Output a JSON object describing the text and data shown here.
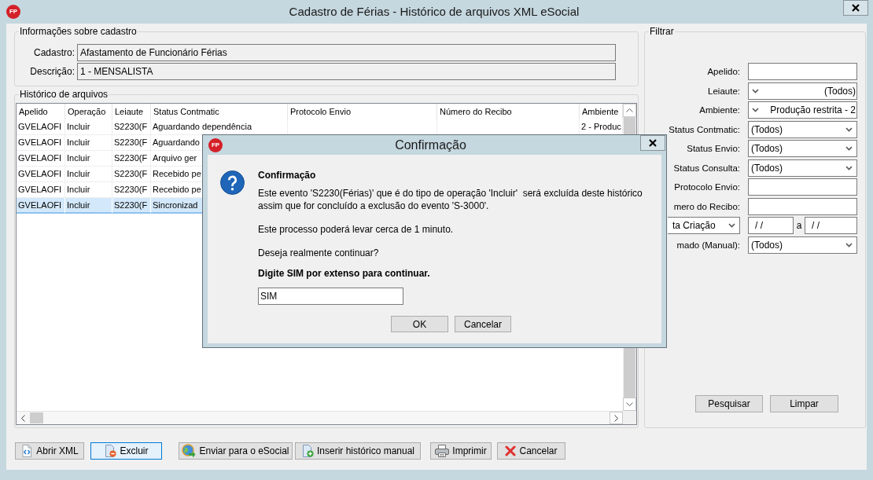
{
  "window": {
    "logo": "FP",
    "title": "Cadastro de Férias - Histórico de arquivos XML eSocial"
  },
  "cadastro_info": {
    "title": "Informações sobre cadastro",
    "fields": [
      {
        "label": "Cadastro:",
        "value": "Afastamento de Funcionário Férias"
      },
      {
        "label": "Descrição:",
        "value": "1 - MENSALISTA"
      }
    ]
  },
  "history": {
    "title": "Histórico de arquivos",
    "table": {
      "columns": [
        "Apelido",
        "Operação",
        "Leiaute",
        "Status Contmatic",
        "Protocolo Envio",
        "Número do Recibo",
        "Ambiente"
      ],
      "rows": [
        {
          "apelido": "GVELAOFI",
          "operacao": "Incluir",
          "leiaute": "S2230(F",
          "status_contmatic": "Aguardando dependência",
          "ambiente": "2 - Produc",
          "selected": false
        },
        {
          "apelido": "GVELAOFI",
          "operacao": "Incluir",
          "leiaute": "S2230(F",
          "status_contmatic": "Aguardando",
          "selected": false
        },
        {
          "apelido": "GVELAOFI",
          "operacao": "Incluir",
          "leiaute": "S2230(F",
          "status_contmatic": "Arquivo ger",
          "selected": false
        },
        {
          "apelido": "GVELAOFI",
          "operacao": "Incluir",
          "leiaute": "S2230(F",
          "status_contmatic": "Recebido pe",
          "selected": false
        },
        {
          "apelido": "GVELAOFI",
          "operacao": "Incluir",
          "leiaute": "S2230(F",
          "status_contmatic": "Recebido pe",
          "selected": false
        },
        {
          "apelido": "GVELAOFI",
          "operacao": "Incluir",
          "leiaute": "S2230(F",
          "status_contmatic": "Sincronizad",
          "selected": true
        }
      ]
    }
  },
  "filter": {
    "title": "Filtrar",
    "fields": [
      {
        "kind": "text",
        "label": "Apelido:"
      },
      {
        "kind": "picker",
        "label": "Leiaute:",
        "value": "(Todos)"
      },
      {
        "kind": "picker",
        "label": "Ambiente:",
        "value": "Produção restrita - 2"
      },
      {
        "kind": "dropdown",
        "label": "Status Contmatic:",
        "value": "(Todos)"
      },
      {
        "kind": "dropdown",
        "label": "Status Envio:",
        "value": "(Todos)"
      },
      {
        "kind": "dropdown",
        "label": "Status Consulta:",
        "value": "(Todos)"
      },
      {
        "kind": "text",
        "label": "Protocolo Envio:"
      },
      {
        "kind": "text",
        "label": "mero do Recibo:"
      },
      {
        "kind": "date-range",
        "selector": "ta Criação",
        "from": "/ /",
        "separator": "a",
        "to": "/ /"
      },
      {
        "kind": "dropdown",
        "label": "mado (Manual):",
        "value": "(Todos)"
      }
    ],
    "buttons": [
      "Pesquisar",
      "Limpar"
    ]
  },
  "buttons": [
    {
      "label": "Abrir XML",
      "focused": false
    },
    {
      "label": "Excluir",
      "focused": true
    },
    {
      "label": "Enviar para o eSocial",
      "focused": false
    },
    {
      "label": "Inserir histórico manual",
      "focused": false
    },
    {
      "label": "Imprimir",
      "focused": false
    },
    {
      "label": "Cancelar",
      "focused": false
    }
  ],
  "dialog": {
    "logo": "FP",
    "title": "Confirmação",
    "heading": "Confirmação",
    "message": "Este evento 'S2230(Férias)' que é do tipo de operação 'Incluir'  será excluída deste histórico\nassim que for concluído a exclusão do evento 'S-3000'.",
    "note": "Este processo poderá levar cerca de 1 minuto.",
    "question": "Deseja realmente continuar?",
    "prompt": "Digite SIM por extenso para continuar.",
    "answer": "SIM",
    "buttons": [
      "OK",
      "Cancelar"
    ]
  }
}
